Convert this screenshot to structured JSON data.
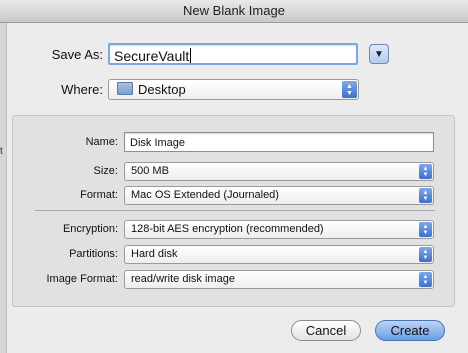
{
  "window": {
    "title": "New Blank Image"
  },
  "left_edge": {
    "mark": "t"
  },
  "save_as": {
    "label": "Save As:",
    "value": "SecureVault"
  },
  "where": {
    "label": "Where:",
    "value": "Desktop"
  },
  "settings": {
    "name": {
      "label": "Name:",
      "value": "Disk Image"
    },
    "size": {
      "label": "Size:",
      "value": "500 MB"
    },
    "format": {
      "label": "Format:",
      "value": "Mac OS Extended (Journaled)"
    },
    "encryption": {
      "label": "Encryption:",
      "value": "128-bit AES encryption (recommended)"
    },
    "partitions": {
      "label": "Partitions:",
      "value": "Hard disk"
    },
    "image_format": {
      "label": "Image Format:",
      "value": "read/write disk image"
    }
  },
  "buttons": {
    "cancel": "Cancel",
    "create": "Create"
  },
  "colors": {
    "default_button": "#6a9ee6",
    "focus_ring": "#7aa7e6",
    "popup_arrows": "#3f6fc8"
  }
}
